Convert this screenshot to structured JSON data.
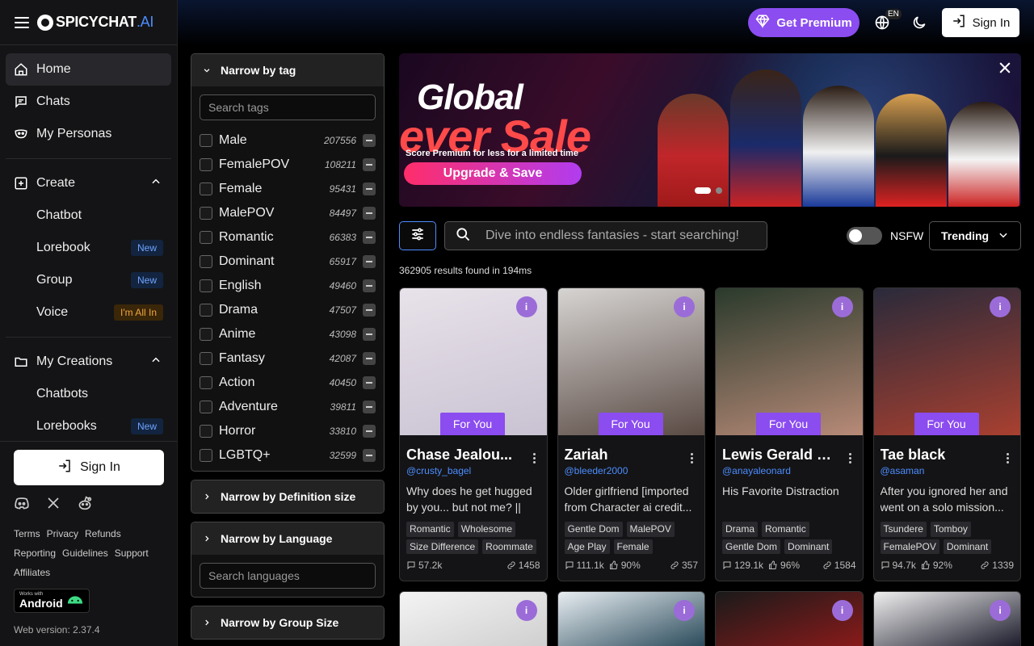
{
  "brand": {
    "name": "SPICYCHAT",
    "suffix": ".AI"
  },
  "sidebar": {
    "nav": [
      {
        "label": "Home",
        "icon": "home-icon"
      },
      {
        "label": "Chats",
        "icon": "chat-icon"
      },
      {
        "label": "My Personas",
        "icon": "mask-icon"
      }
    ],
    "create": {
      "label": "Create",
      "items": [
        {
          "label": "Chatbot",
          "badge": ""
        },
        {
          "label": "Lorebook",
          "badge": "New"
        },
        {
          "label": "Group",
          "badge": "New"
        },
        {
          "label": "Voice",
          "badge": "I'm All In"
        }
      ]
    },
    "creations": {
      "label": "My Creations",
      "items": [
        {
          "label": "Chatbots",
          "badge": ""
        },
        {
          "label": "Lorebooks",
          "badge": "New"
        }
      ]
    },
    "sign_in": "Sign In",
    "footer_links": [
      "Terms",
      "Privacy",
      "Refunds",
      "Reporting",
      "Guidelines",
      "Support",
      "Affiliates"
    ],
    "android": {
      "line1": "Works with",
      "line2": "Android"
    },
    "version": "Web version: 2.37.4"
  },
  "topbar": {
    "premium": "Get Premium",
    "lang": "EN",
    "sign_in": "Sign In"
  },
  "filters": {
    "tag_title": "Narrow by tag",
    "tag_search_placeholder": "Search tags",
    "tags": [
      {
        "name": "Male",
        "count": "207556"
      },
      {
        "name": "FemalePOV",
        "count": "108211"
      },
      {
        "name": "Female",
        "count": "95431"
      },
      {
        "name": "MalePOV",
        "count": "84497"
      },
      {
        "name": "Romantic",
        "count": "66383"
      },
      {
        "name": "Dominant",
        "count": "65917"
      },
      {
        "name": "English",
        "count": "49460"
      },
      {
        "name": "Drama",
        "count": "47507"
      },
      {
        "name": "Anime",
        "count": "43098"
      },
      {
        "name": "Fantasy",
        "count": "42087"
      },
      {
        "name": "Action",
        "count": "40450"
      },
      {
        "name": "Adventure",
        "count": "39811"
      },
      {
        "name": "Horror",
        "count": "33810"
      },
      {
        "name": "LGBTQ+",
        "count": "32599"
      }
    ],
    "definition_title": "Narrow by Definition size",
    "language_title": "Narrow by Language",
    "language_search_placeholder": "Search languages",
    "group_title": "Narrow by Group Size"
  },
  "banner": {
    "title_line1": "Global",
    "title_line2": "ever Sale",
    "subtitle": "Score Premium for less for a limited time",
    "cta": "Upgrade & Save"
  },
  "search": {
    "placeholder": "Dive into endless fantasies - start searching!",
    "nsfw_label": "NSFW",
    "sort": "Trending"
  },
  "results_text": "362905 results found in 194ms",
  "cards": [
    {
      "badge": "For You",
      "name": "Chase     Jealou...",
      "handle": "@crusty_bagel",
      "desc": "Why does he get hugged by you... but not me? || BL...",
      "tags": [
        "Romantic",
        "Wholesome",
        "Size Difference",
        "Roommate"
      ],
      "chats": "57.2k",
      "likes": "",
      "bots": "1458",
      "colors": [
        "#e8e2ea",
        "#c9c2d2"
      ]
    },
    {
      "badge": "For You",
      "name": "Zariah",
      "handle": "@bleeder2000",
      "desc": "Older girlfriend [imported from Character ai credit...",
      "tags": [
        "Gentle Dom",
        "MalePOV",
        "Age Play",
        "Female"
      ],
      "chats": "111.1k",
      "likes": "90%",
      "bots": "357",
      "colors": [
        "#d6d4d2",
        "#5a4a44"
      ]
    },
    {
      "badge": "For You",
      "name": "Lewis Gerald M...",
      "handle": "@anayaleonard",
      "desc": "His Favorite Distraction",
      "tags": [
        "Drama",
        "Romantic",
        "Gentle Dom",
        "Dominant"
      ],
      "chats": "129.1k",
      "likes": "96%",
      "bots": "1584",
      "colors": [
        "#2a3a2c",
        "#b88a78"
      ]
    },
    {
      "badge": "For You",
      "name": "Tae black",
      "handle": "@asaman",
      "desc": "After you ignored her and went on a solo mission...",
      "tags": [
        "Tsundere",
        "Tomboy",
        "FemalePOV",
        "Dominant"
      ],
      "chats": "94.7k",
      "likes": "92%",
      "bots": "1339",
      "colors": [
        "#2a2a3a",
        "#a84030"
      ]
    }
  ]
}
